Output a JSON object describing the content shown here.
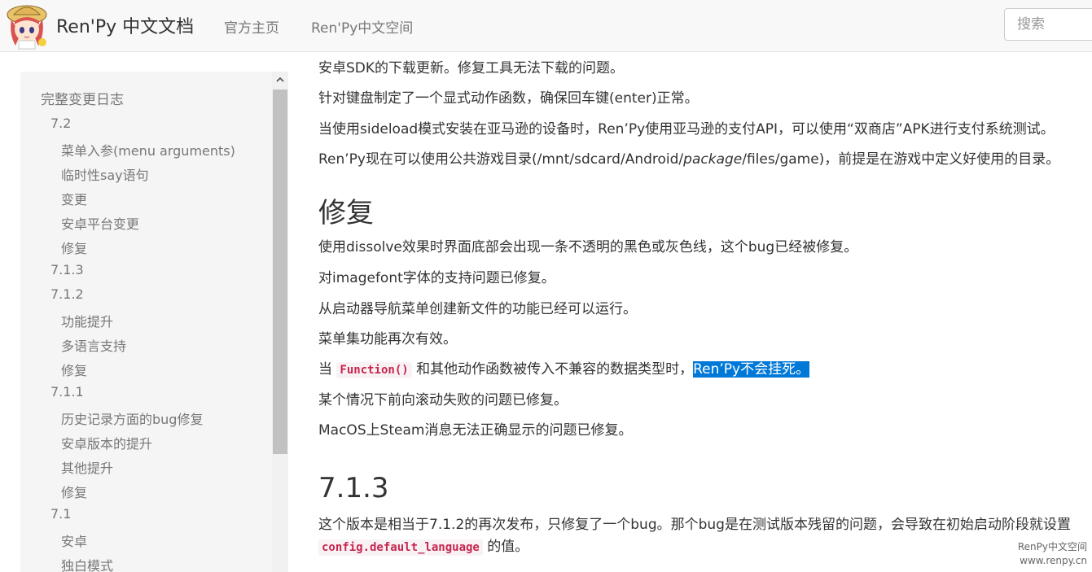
{
  "navbar": {
    "brand": "Ren'Py 中文文档",
    "links": [
      "官方主页",
      "Ren'Py中文空间"
    ],
    "search_placeholder": "搜索"
  },
  "sidebar": {
    "items": [
      {
        "label": "完整变更日志",
        "level": 0
      },
      {
        "label": "7.2",
        "level": 1
      },
      {
        "label": "菜单入参(menu arguments)",
        "level": 2
      },
      {
        "label": "临时性say语句",
        "level": 2
      },
      {
        "label": "变更",
        "level": 2
      },
      {
        "label": "安卓平台变更",
        "level": 2
      },
      {
        "label": "修复",
        "level": 2
      },
      {
        "label": "7.1.3",
        "level": 1
      },
      {
        "label": "7.1.2",
        "level": 1
      },
      {
        "label": "功能提升",
        "level": 2
      },
      {
        "label": "多语言支持",
        "level": 2
      },
      {
        "label": "修复",
        "level": 2
      },
      {
        "label": "7.1.1",
        "level": 1
      },
      {
        "label": "历史记录方面的bug修复",
        "level": 2
      },
      {
        "label": "安卓版本的提升",
        "level": 2
      },
      {
        "label": "其他提升",
        "level": 2
      },
      {
        "label": "修复",
        "level": 2
      },
      {
        "label": "7.1",
        "level": 1
      },
      {
        "label": "安卓",
        "level": 2
      },
      {
        "label": "独白模式",
        "level": 2
      }
    ]
  },
  "content": {
    "p1": "安卓SDK的下载更新。修复工具无法下载的问题。",
    "p2": "针对键盘制定了一个显式动作函数，确保回车键(enter)正常。",
    "p3": "当使用sideload模式安装在亚马逊的设备时，Ren’Py使用亚马逊的支付API，可以使用“双商店”APK进行支付系统测试。",
    "p4_before": "Ren’Py现在可以使用公共游戏目录(/mnt/sdcard/Android/",
    "p4_italic": "package",
    "p4_after": "/files/game)，前提是在游戏中定义好使用的目录。",
    "h_fix": "修复",
    "f1": "使用dissolve效果时界面底部会出现一条不透明的黑色或灰色线，这个bug已经被修复。",
    "f2": "对imagefont字体的支持问题已修复。",
    "f3": "从启动器导航菜单创建新文件的功能已经可以运行。",
    "f4": "菜单集功能再次有效。",
    "f5_before": "当 ",
    "f5_code": "Function()",
    "f5_middle": " 和其他动作函数被传入不兼容的数据类型时，",
    "f5_selected": "Ren’Py不会挂死。",
    "f6": "某个情况下前向滚动失败的问题已修复。",
    "f7": "MacOS上Steam消息无法正确显示的问题已修复。",
    "h_713": "7.1.3",
    "r1": "这个版本是相当于7.1.2的再次发布，只修复了一个bug。那个bug是在测试版本残留的问题，会导致在初始启动阶段就设置",
    "r2_code": "config.default_language",
    "r2_after": " 的值。"
  },
  "watermark": {
    "line1": "RenPy中文空间",
    "line2": "www.renpy.cn"
  }
}
